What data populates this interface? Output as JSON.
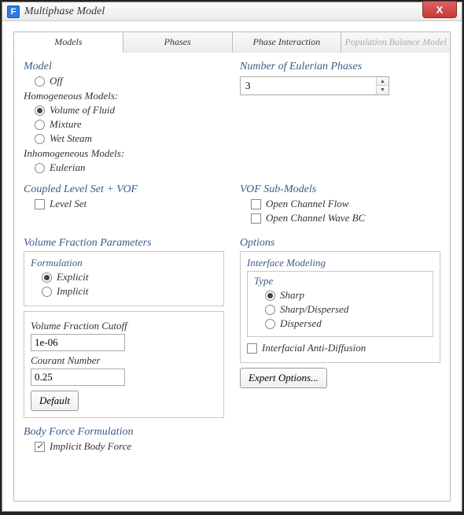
{
  "window": {
    "title": "Multiphase Model",
    "close": "X",
    "app_icon_letter": "F"
  },
  "tabs": {
    "models": "Models",
    "phases": "Phases",
    "interaction": "Phase Interaction",
    "population": "Population Balance Model"
  },
  "model": {
    "title": "Model",
    "off": "Off",
    "homogeneous": "Homogeneous Models:",
    "vof": "Volume of Fluid",
    "mixture": "Mixture",
    "wet_steam": "Wet Steam",
    "inhomogeneous": "Inhomogeneous Models:",
    "eulerian": "Eulerian"
  },
  "phases_count": {
    "title": "Number of Eulerian Phases",
    "value": "3"
  },
  "coupled": {
    "title": "Coupled Level Set + VOF",
    "level_set": "Level Set"
  },
  "vof_sub": {
    "title": "VOF Sub-Models",
    "open_channel": "Open Channel Flow",
    "open_channel_wave": "Open Channel Wave BC"
  },
  "vfp": {
    "title": "Volume Fraction Parameters",
    "formulation": "Formulation",
    "explicit": "Explicit",
    "implicit": "Implicit",
    "cutoff_label": "Volume Fraction Cutoff",
    "cutoff_value": "1e-06",
    "courant_label": "Courant Number",
    "courant_value": "0.25",
    "default_btn": "Default"
  },
  "options": {
    "title": "Options",
    "interface": "Interface Modeling",
    "type": "Type",
    "sharp": "Sharp",
    "sharp_dispersed": "Sharp/Dispersed",
    "dispersed": "Dispersed",
    "anti_diffusion": "Interfacial Anti-Diffusion",
    "expert": "Expert Options..."
  },
  "body_force": {
    "title": "Body Force Formulation",
    "implicit": "Implicit Body Force"
  }
}
